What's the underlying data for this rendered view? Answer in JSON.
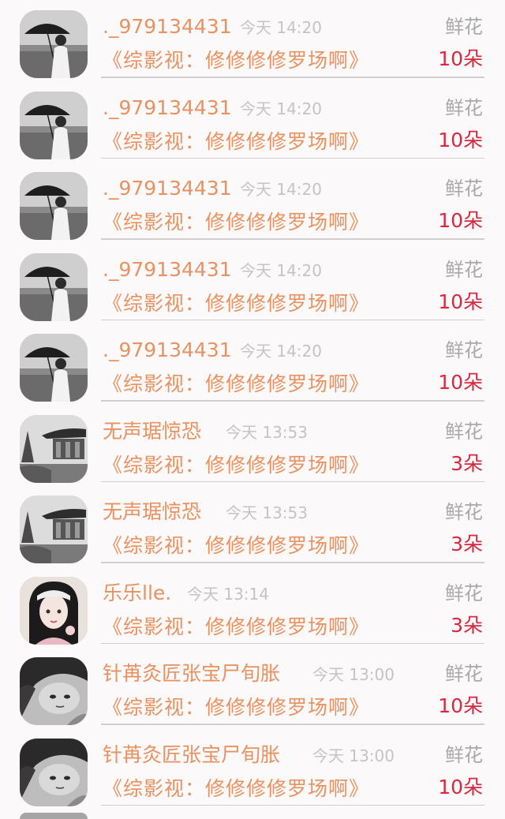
{
  "rows": [
    {
      "name": "._979134431",
      "time": "今天 14:20",
      "gift": "鲜花",
      "title": "《综影视：修修修修罗场啊》",
      "count": "10朵",
      "avatar": "umbrella-girl-avatar"
    },
    {
      "name": "._979134431",
      "time": "今天 14:20",
      "gift": "鲜花",
      "title": "《综影视：修修修修罗场啊》",
      "count": "10朵",
      "avatar": "umbrella-girl-avatar"
    },
    {
      "name": "._979134431",
      "time": "今天 14:20",
      "gift": "鲜花",
      "title": "《综影视：修修修修罗场啊》",
      "count": "10朵",
      "avatar": "umbrella-girl-avatar"
    },
    {
      "name": "._979134431",
      "time": "今天 14:20",
      "gift": "鲜花",
      "title": "《综影视：修修修修罗场啊》",
      "count": "10朵",
      "avatar": "umbrella-girl-avatar"
    },
    {
      "name": "._979134431",
      "time": "今天 14:20",
      "gift": "鲜花",
      "title": "《综影视：修修修修罗场啊》",
      "count": "10朵",
      "avatar": "umbrella-girl-avatar"
    },
    {
      "name": "无声琚惊恐",
      "time": "今天 13:53",
      "gift": "鲜花",
      "title": "《综影视：修修修修罗场啊》",
      "count": "3朵",
      "avatar": "pavilion-avatar"
    },
    {
      "name": "无声琚惊恐",
      "time": "今天 13:53",
      "gift": "鲜花",
      "title": "《综影视：修修修修罗场啊》",
      "count": "3朵",
      "avatar": "pavilion-avatar"
    },
    {
      "name": "乐乐lle.",
      "time": "今天 13:14",
      "gift": "鲜花",
      "title": "《综影视：修修修修罗场啊》",
      "count": "3朵",
      "avatar": "portrait-girl-avatar"
    },
    {
      "name": "针苒灸匠张宝尸旬胀",
      "time": "今天 13:00",
      "gift": "鲜花",
      "title": "《综影视：修修修修罗场啊》",
      "count": "10朵",
      "avatar": "lying-girl-avatar"
    },
    {
      "name": "针苒灸匠张宝尸旬胀",
      "time": "今天 13:00",
      "gift": "鲜花",
      "title": "《综影视：修修修修罗场啊》",
      "count": "10朵",
      "avatar": "lying-girl-avatar"
    }
  ],
  "colors": {
    "name": "#e9915f",
    "time": "#c4c4c4",
    "gift": "#a9a9a9",
    "count": "#d8283f",
    "background": "#fbf9fa"
  }
}
